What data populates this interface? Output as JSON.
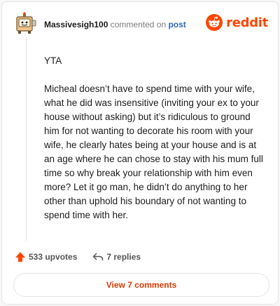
{
  "comment": {
    "username": "Massivesigh100",
    "action_text": "commented on",
    "target_link": "post",
    "paragraphs": [
      "YTA",
      "Micheal doesn’t have to spend time with your wife, what he did was insensitive (inviting your ex to your house without asking) but it’s ridiculous to ground him for not wanting to decorate his room with your wife, he clearly hates being at your house and is at an age where he can chose to stay with his mum full time so why break your relationship with him even more? Let it go man, he didn’t do anything to her other than uphold his boundary of not wanting to spend time with her."
    ]
  },
  "brand": {
    "name": "reddit",
    "logo_icon": "reddit-snoo-icon",
    "color": "#ff4500"
  },
  "actions": {
    "upvotes_label": "533 upvotes",
    "replies_label": "7 replies"
  },
  "view_comments_label": "View 7 comments",
  "colors": {
    "accent": "#ff4500",
    "link": "#2a6ab5",
    "view_button_text": "#d93a00"
  }
}
